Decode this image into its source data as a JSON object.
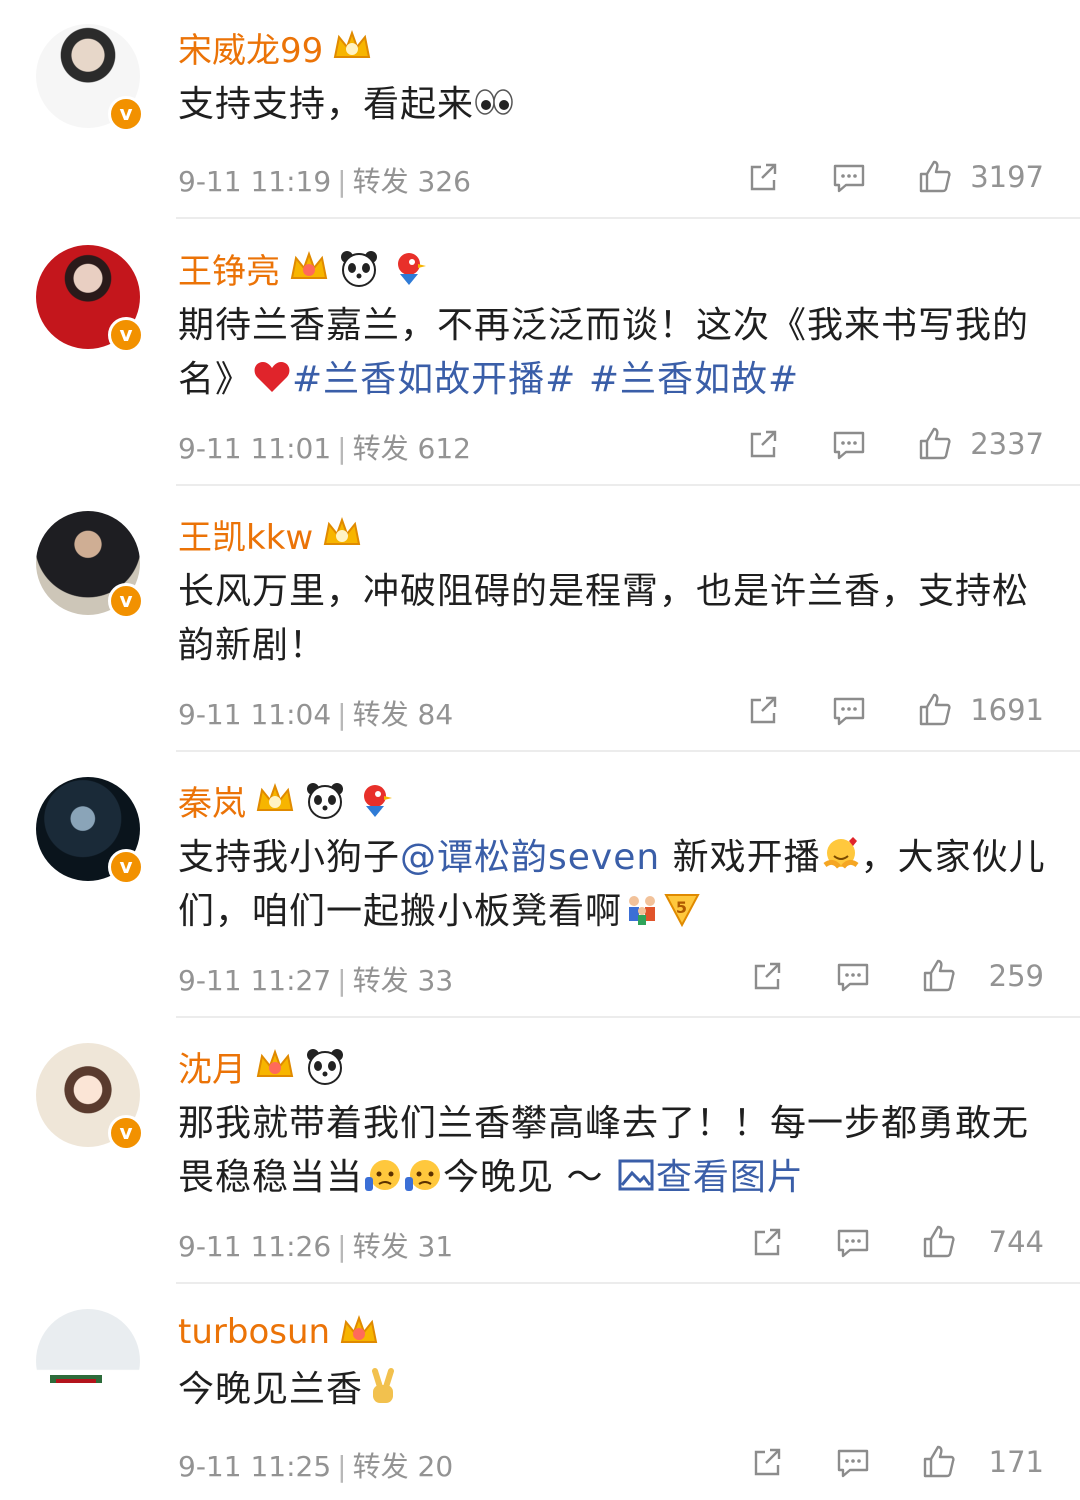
{
  "comments": [
    {
      "user": "宋威龙99",
      "text_parts": [
        "支持支持，看起来"
      ],
      "time": "9-11 11:19",
      "repost_label": "转发",
      "reposts": "326",
      "likes": "3197",
      "avatar_colors": [
        "#d9d9d9",
        "#f2f2f2"
      ]
    },
    {
      "user": "王铮亮",
      "text_parts": [
        "期待兰香嘉兰，不再泛泛而谈！这次《我来书写我的名》"
      ],
      "hashtags": [
        "#兰香如故开播#",
        "#兰香如故#"
      ],
      "time": "9-11 11:01",
      "repost_label": "转发",
      "reposts": "612",
      "likes": "2337",
      "avatar_colors": [
        "#b3141c",
        "#e63946"
      ]
    },
    {
      "user": "王凯kkw",
      "text_parts": [
        "长风万里，冲破阻碍的是程霄，也是许兰香，支持松韵新剧！"
      ],
      "time": "9-11 11:04",
      "repost_label": "转发",
      "reposts": "84",
      "likes": "1691",
      "avatar_colors": [
        "#3a3a3a",
        "#bfbab0"
      ]
    },
    {
      "user": "秦岚",
      "text_parts": [
        "支持我小狗子",
        "新戏开播",
        "，大家伙儿们，咱们一起搬小板凳看啊"
      ],
      "mention": "@谭松韵seven",
      "time": "9-11 11:27",
      "repost_label": "转发",
      "reposts": "33",
      "likes": "259",
      "avatar_colors": [
        "#0c1a26",
        "#4a6a86"
      ]
    },
    {
      "user": "沈月",
      "text_parts": [
        "那我就带着我们兰香攀高峰去了！！每一步都勇敢无畏稳稳当当",
        "今晚见 ～ "
      ],
      "link_text": "查看图片",
      "time": "9-11 11:26",
      "repost_label": "转发",
      "reposts": "31",
      "likes": "744",
      "avatar_colors": [
        "#f4efe8",
        "#e0b4b4"
      ]
    },
    {
      "user": "turbosun",
      "text_parts": [
        "今晚见兰香"
      ],
      "time": "9-11 11:25",
      "repost_label": "转发",
      "reposts": "20",
      "likes": "171",
      "avatar_colors": [
        "#e8ecef",
        "#ffffff"
      ]
    }
  ],
  "colors": {
    "username": "#eb7307",
    "link": "#3a5ea8",
    "meta": "#939393",
    "verified": "#f29100"
  },
  "icons": {
    "share": "share-icon",
    "comment": "comment-icon",
    "like": "thumbs-up-icon",
    "crown": "crown-badge-icon",
    "panda": "panda-badge-icon",
    "bird": "bird-badge-icon"
  }
}
